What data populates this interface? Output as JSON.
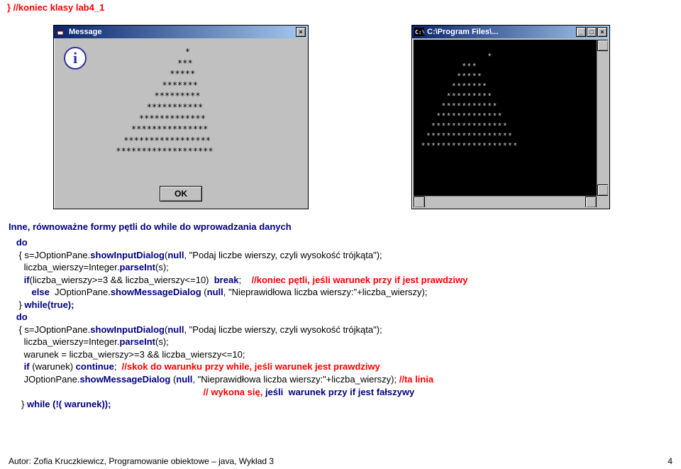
{
  "top_comment": "} //koniec klasy lab4_1",
  "msg_window": {
    "title": "Message",
    "stars": "         *\n        ***\n       *****\n      *******\n     *********\n    ***********\n   *************\n  ***************\n *****************\n*******************",
    "ok": "OK"
  },
  "cmd_window": {
    "title_path": "C:\\Program Files\\...",
    "stars": "         *\n        ***\n       *****\n      *******\n     *********\n    ***********\n   *************\n  ***************\n *****************\n*******************"
  },
  "heading": "Inne, równoważne formy pętli do while do wprowadzania danych",
  "code": {
    "l1_a": "   do",
    "l2": "    { s=JOptionPane.",
    "l2b": "showInputDialog",
    "l2c": "(",
    "l2d": "null",
    "l2e": ", \"Podaj liczbe wierszy, czyli wysokość trójkąta\");",
    "l3": "      liczba_wierszy=Integer.",
    "l3b": "parseInt",
    "l3c": "(s);",
    "l4a": "      if",
    "l4b": "(liczba_wierszy>=3 && liczba_wierszy<=10)  ",
    "l4c": "break",
    "l4d": ";    ",
    "l4e": "//koniec pętli, jeśli warunek przy if jest prawdziwy",
    "l5a": "         else",
    "l5b": "  JOptionPane.",
    "l5c": "showMessageDialog ",
    "l5d": "(",
    "l5e": "null",
    "l5f": ", \"Nieprawidłowa liczba wierszy:\"+liczba_wierszy);",
    "l6a": "    } ",
    "l6b": "while(true);",
    "l7": "   do",
    "l8": "    { s=JOptionPane.",
    "l8b": "showInputDialog",
    "l8c": "(",
    "l8d": "null",
    "l8e": ", \"Podaj liczbe wierszy, czyli wysokość trójkąta\");",
    "l9": "      liczba_wierszy=Integer.",
    "l9b": "parseInt",
    "l9c": "(s);",
    "l10": "      warunek = liczba_wierszy>=3 && liczba_wierszy<=10;",
    "l11a": "      if ",
    "l11b": "(warunek) ",
    "l11c": "continue",
    "l11d": ";  ",
    "l11e": "//skok do warunku przy while, jeśli warunek jest prawdziwy",
    "l12a": "      JOptionPane.",
    "l12b": "showMessageDialog ",
    "l12c": "(",
    "l12d": "null",
    "l12e": ", \"Nieprawidłowa liczba wierszy:\"+liczba_wierszy); ",
    "l12f": "//ta linia",
    "l13": "                                                                            // wykona się, ",
    "l13b": "jeśli  warunek przy if jest fałszywy",
    "l14a": "     } ",
    "l14b": "while (!( warunek));"
  },
  "footer": {
    "left": "Autor: Zofia Kruczkiewicz, Programowanie obiektowe – java, Wykład 3",
    "right": "4"
  }
}
